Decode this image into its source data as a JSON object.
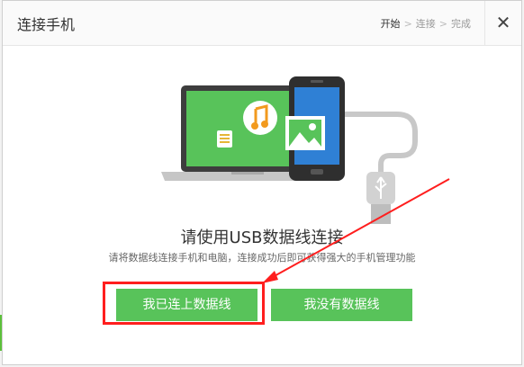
{
  "dialog": {
    "title": "连接手机",
    "steps": [
      "开始",
      "连接",
      "完成"
    ],
    "steps_separator": ">",
    "close_label": "✕"
  },
  "content": {
    "headline": "请使用USB数据线连接",
    "subtext": "请将数据线连接手机和电脑，连接成功后即可获得强大的手机管理功能"
  },
  "buttons": {
    "connected_label": "我已连上数据线",
    "no_cable_label": "我没有数据线"
  },
  "colors": {
    "accent_green": "#58c35a",
    "highlight_red": "#ff1e1e",
    "music_orange": "#f29a1e",
    "usb_cable_gray": "#c8c8c8"
  },
  "icons": [
    "music-note-icon",
    "picture-icon",
    "document-icon",
    "usb-connector-icon",
    "close-icon"
  ]
}
